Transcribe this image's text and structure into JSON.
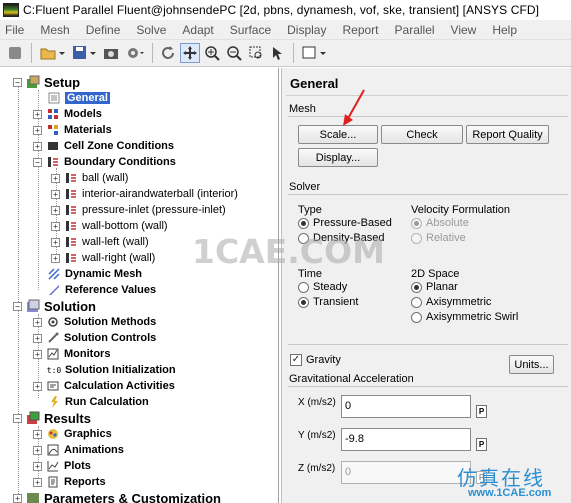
{
  "window": {
    "title": "C:Fluent Parallel Fluent@johnsendePC  [2d, pbns, dynamesh, vof, ske, transient] [ANSYS CFD]"
  },
  "menu": [
    "File",
    "Mesh",
    "Define",
    "Solve",
    "Adapt",
    "Surface",
    "Display",
    "Report",
    "Parallel",
    "View",
    "Help"
  ],
  "toolbar": {
    "icons": [
      "print-icon",
      "open-folder-icon",
      "save-icon",
      "snapshot-icon",
      "settings-icon",
      "rotate-icon",
      "pan-icon",
      "zoom-in-icon",
      "zoom-out-icon",
      "zoom-box-icon",
      "select-icon",
      "window-icon"
    ]
  },
  "tree": {
    "setup": {
      "label": "Setup",
      "items": [
        "General",
        "Models",
        "Materials",
        "Cell Zone Conditions",
        "Boundary Conditions",
        "Dynamic Mesh",
        "Reference Values"
      ],
      "boundaries": [
        "ball (wall)",
        "interior-airandwaterball (interior)",
        "pressure-inlet (pressure-inlet)",
        "wall-bottom (wall)",
        "wall-left (wall)",
        "wall-right (wall)"
      ]
    },
    "solution": {
      "label": "Solution",
      "items": [
        "Solution Methods",
        "Solution Controls",
        "Monitors",
        "Solution Initialization",
        "Calculation Activities",
        "Run Calculation"
      ]
    },
    "results": {
      "label": "Results",
      "items": [
        "Graphics",
        "Animations",
        "Plots",
        "Reports"
      ]
    },
    "parameters": {
      "label": "Parameters & Customization"
    }
  },
  "panel": {
    "title": "General",
    "mesh": {
      "label": "Mesh",
      "scale": "Scale...",
      "check": "Check",
      "report_quality": "Report Quality",
      "display": "Display..."
    },
    "solver": {
      "label": "Solver",
      "type_label": "Type",
      "type_options": [
        "Pressure-Based",
        "Density-Based"
      ],
      "velocity_label": "Velocity Formulation",
      "velocity_options": [
        "Absolute",
        "Relative"
      ],
      "time_label": "Time",
      "time_options": [
        "Steady",
        "Transient"
      ],
      "space_label": "2D Space",
      "space_options": [
        "Planar",
        "Axisymmetric",
        "Axisymmetric Swirl"
      ]
    },
    "gravity": {
      "label": "Gravity",
      "units": "Units...",
      "accel_label": "Gravitational Acceleration",
      "x_label": "X (m/s2)",
      "x_value": "0",
      "y_label": "Y (m/s2)",
      "y_value": "-9.8",
      "z_label": "Z (m/s2)",
      "z_value": "0",
      "p": "P"
    }
  },
  "watermarks": {
    "center": "1CAE.COM",
    "cn": "仿真在线",
    "url": "www.1CAE.com"
  },
  "colors": {
    "selection": "#3366cc",
    "panel_bg": "#f0f0f0",
    "watermark": "#2a8fd0",
    "arrow": "#e02020"
  }
}
